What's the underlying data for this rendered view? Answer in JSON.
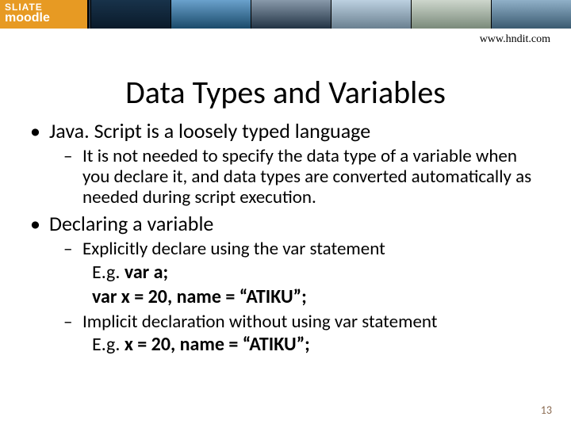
{
  "banner": {
    "logo_line1": "SLIATE",
    "logo_line2": "moodle"
  },
  "url": "www.hndit.com",
  "title": "Data Types and Variables",
  "bullets": {
    "b1": "Java. Script is a loosely typed language",
    "b1_sub1": "It is not needed to specify the data type of a variable when you declare it, and data types are converted automatically as needed during script execution.",
    "b2": "Declaring a variable",
    "b2_sub1": "Explicitly declare using the var statement",
    "b2_sub1_ex_label": "E.g. ",
    "b2_sub1_ex_code1": "var a;",
    "b2_sub1_ex_code2": "var x = 20, name = “ATIKU”;",
    "b2_sub2": "Implicit declaration without using var statement",
    "b2_sub2_ex_label": "E.g. ",
    "b2_sub2_ex_code": "x = 20, name = “ATIKU”;"
  },
  "page_number": "13"
}
